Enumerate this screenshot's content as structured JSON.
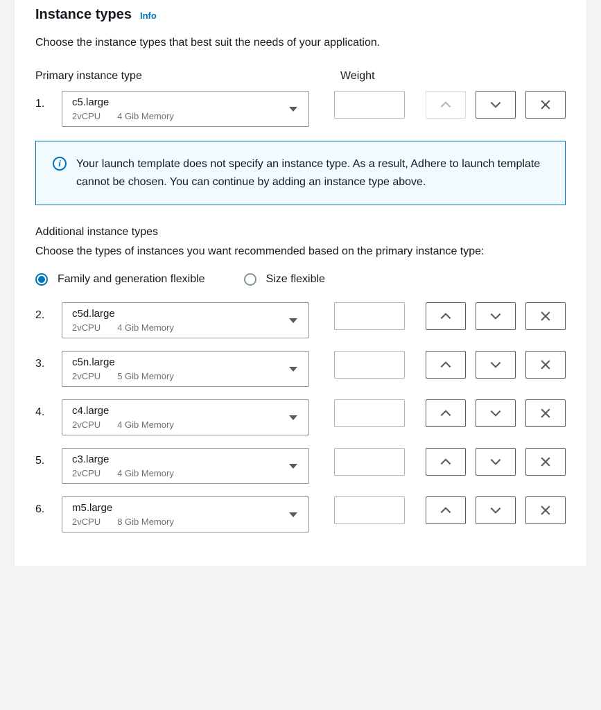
{
  "header": {
    "title": "Instance types",
    "info": "Info"
  },
  "description": "Choose the instance types that best suit the needs of your application.",
  "labels": {
    "primary": "Primary instance type",
    "weight": "Weight"
  },
  "primary": {
    "number": "1.",
    "name": "c5.large",
    "vcpu": "2vCPU",
    "memory": "4 Gib Memory",
    "weight": ""
  },
  "alert": {
    "text": "Your launch template does not specify an instance type. As a result, Adhere to launch template cannot be chosen. You can continue by adding an instance type above."
  },
  "additional": {
    "title": "Additional instance types",
    "help": "Choose the types of instances you want recommended based on the primary instance type:"
  },
  "flex_options": {
    "family": "Family and generation flexible",
    "size": "Size flexible"
  },
  "rows": [
    {
      "number": "2.",
      "name": "c5d.large",
      "vcpu": "2vCPU",
      "memory": "4 Gib Memory",
      "weight": ""
    },
    {
      "number": "3.",
      "name": "c5n.large",
      "vcpu": "2vCPU",
      "memory": "5 Gib Memory",
      "weight": ""
    },
    {
      "number": "4.",
      "name": "c4.large",
      "vcpu": "2vCPU",
      "memory": "4 Gib Memory",
      "weight": ""
    },
    {
      "number": "5.",
      "name": "c3.large",
      "vcpu": "2vCPU",
      "memory": "4 Gib Memory",
      "weight": ""
    },
    {
      "number": "6.",
      "name": "m5.large",
      "vcpu": "2vCPU",
      "memory": "8 Gib Memory",
      "weight": ""
    }
  ]
}
